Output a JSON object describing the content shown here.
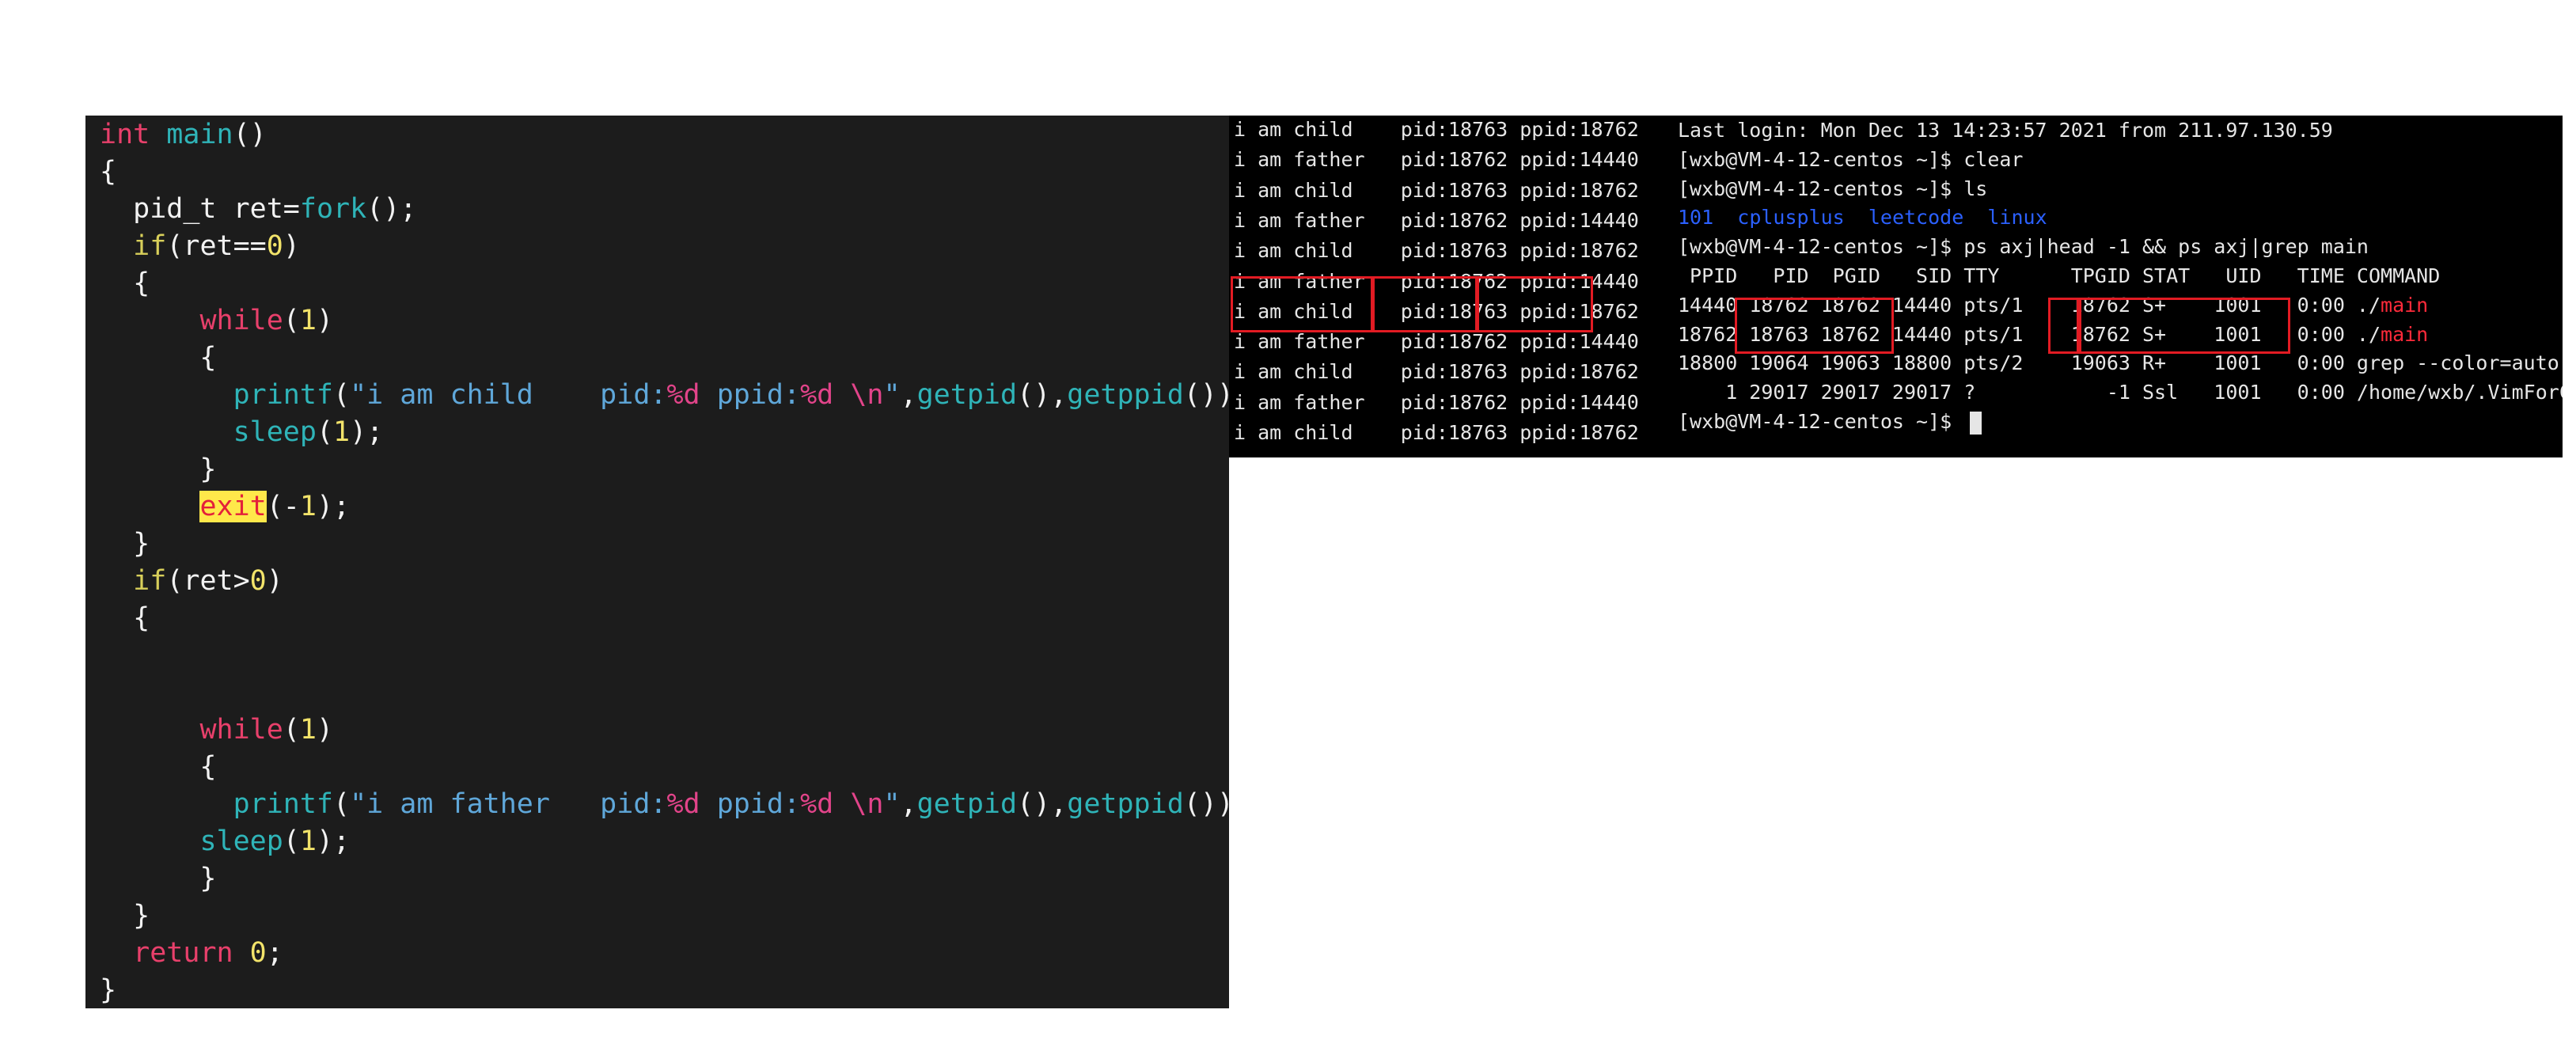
{
  "editor": {
    "lines": [
      [
        {
          "t": "int",
          "c": "kw"
        },
        {
          "t": " ",
          "c": "pl"
        },
        {
          "t": "main",
          "c": "fn"
        },
        {
          "t": "()",
          "c": "pl"
        }
      ],
      [
        {
          "t": "{",
          "c": "pl"
        }
      ],
      [
        {
          "t": "  pid_t ret=",
          "c": "pl"
        },
        {
          "t": "fork",
          "c": "fn"
        },
        {
          "t": "();",
          "c": "pl"
        }
      ],
      [
        {
          "t": "  ",
          "c": "pl"
        },
        {
          "t": "if",
          "c": "ctl"
        },
        {
          "t": "(ret==",
          "c": "pl"
        },
        {
          "t": "0",
          "c": "num"
        },
        {
          "t": ")",
          "c": "pl"
        }
      ],
      [
        {
          "t": "  {",
          "c": "pl"
        }
      ],
      [
        {
          "t": "      ",
          "c": "pl"
        },
        {
          "t": "while",
          "c": "kw"
        },
        {
          "t": "(",
          "c": "pl"
        },
        {
          "t": "1",
          "c": "num"
        },
        {
          "t": ")",
          "c": "pl"
        }
      ],
      [
        {
          "t": "      {",
          "c": "pl"
        }
      ],
      [
        {
          "t": "        ",
          "c": "pl"
        },
        {
          "t": "printf",
          "c": "fn"
        },
        {
          "t": "(",
          "c": "pl"
        },
        {
          "t": "\"i am child    pid:",
          "c": "str"
        },
        {
          "t": "%d",
          "c": "fmt"
        },
        {
          "t": " ppid:",
          "c": "str"
        },
        {
          "t": "%d",
          "c": "fmt"
        },
        {
          "t": " ",
          "c": "str"
        },
        {
          "t": "\\n",
          "c": "fmt"
        },
        {
          "t": "\"",
          "c": "str"
        },
        {
          "t": ",",
          "c": "pl"
        },
        {
          "t": "getpid",
          "c": "fn"
        },
        {
          "t": "(),",
          "c": "pl"
        },
        {
          "t": "getppid",
          "c": "fn"
        },
        {
          "t": "());",
          "c": "pl"
        }
      ],
      [
        {
          "t": "        ",
          "c": "pl"
        },
        {
          "t": "sleep",
          "c": "fn"
        },
        {
          "t": "(",
          "c": "pl"
        },
        {
          "t": "1",
          "c": "num"
        },
        {
          "t": ");",
          "c": "pl"
        }
      ],
      [
        {
          "t": "      }",
          "c": "pl"
        }
      ],
      [
        {
          "t": "      ",
          "c": "pl"
        },
        {
          "t": "exit",
          "c": "hl"
        },
        {
          "t": "(-",
          "c": "pl"
        },
        {
          "t": "1",
          "c": "num"
        },
        {
          "t": ");",
          "c": "pl"
        }
      ],
      [
        {
          "t": "  }",
          "c": "pl"
        }
      ],
      [
        {
          "t": "  ",
          "c": "pl"
        },
        {
          "t": "if",
          "c": "ctl"
        },
        {
          "t": "(ret>",
          "c": "pl"
        },
        {
          "t": "0",
          "c": "num"
        },
        {
          "t": ")",
          "c": "pl"
        }
      ],
      [
        {
          "t": "  {",
          "c": "pl"
        }
      ],
      [
        {
          "t": "",
          "c": "pl"
        }
      ],
      [
        {
          "t": "",
          "c": "pl"
        }
      ],
      [
        {
          "t": "      ",
          "c": "pl"
        },
        {
          "t": "while",
          "c": "kw"
        },
        {
          "t": "(",
          "c": "pl"
        },
        {
          "t": "1",
          "c": "num"
        },
        {
          "t": ")",
          "c": "pl"
        }
      ],
      [
        {
          "t": "      {",
          "c": "pl"
        }
      ],
      [
        {
          "t": "        ",
          "c": "pl"
        },
        {
          "t": "printf",
          "c": "fn"
        },
        {
          "t": "(",
          "c": "pl"
        },
        {
          "t": "\"i am father   pid:",
          "c": "str"
        },
        {
          "t": "%d",
          "c": "fmt"
        },
        {
          "t": " ppid:",
          "c": "str"
        },
        {
          "t": "%d",
          "c": "fmt"
        },
        {
          "t": " ",
          "c": "str"
        },
        {
          "t": "\\n",
          "c": "fmt"
        },
        {
          "t": "\"",
          "c": "str"
        },
        {
          "t": ",",
          "c": "pl"
        },
        {
          "t": "getpid",
          "c": "fn"
        },
        {
          "t": "(),",
          "c": "pl"
        },
        {
          "t": "getppid",
          "c": "fn"
        },
        {
          "t": "());",
          "c": "pl"
        }
      ],
      [
        {
          "t": "      ",
          "c": "pl"
        },
        {
          "t": "sleep",
          "c": "fn"
        },
        {
          "t": "(",
          "c": "pl"
        },
        {
          "t": "1",
          "c": "num"
        },
        {
          "t": ");",
          "c": "pl"
        }
      ],
      [
        {
          "t": "      }",
          "c": "pl"
        }
      ],
      [
        {
          "t": "  }",
          "c": "pl"
        }
      ],
      [
        {
          "t": "  ",
          "c": "pl"
        },
        {
          "t": "return",
          "c": "kw"
        },
        {
          "t": " ",
          "c": "pl"
        },
        {
          "t": "0",
          "c": "num"
        },
        {
          "t": ";",
          "c": "pl"
        }
      ],
      [
        {
          "t": "}",
          "c": "pl"
        }
      ]
    ]
  },
  "output": {
    "lines": [
      "i am child    pid:18763 ppid:18762",
      "i am father   pid:18762 ppid:14440",
      "i am child    pid:18763 ppid:18762",
      "i am father   pid:18762 ppid:14440",
      "i am child    pid:18763 ppid:18762",
      "i am father   pid:18762 ppid:14440",
      "i am child    pid:18763 ppid:18762",
      "i am father   pid:18762 ppid:14440",
      "i am child    pid:18763 ppid:18762",
      "i am father   pid:18762 ppid:14440",
      "i am child    pid:18763 ppid:18762"
    ]
  },
  "terminal": {
    "lines": [
      [
        {
          "t": "Last login: Mon Dec 13 14:23:57 2021 from 211.97.130.59"
        }
      ],
      [
        {
          "t": "[wxb@VM-4-12-centos ~]$ clear"
        }
      ],
      [
        {
          "t": "[wxb@VM-4-12-centos ~]$ ls"
        }
      ],
      [
        {
          "t": "101",
          "c": "ls"
        },
        {
          "t": "  "
        },
        {
          "t": "cplusplus",
          "c": "ls"
        },
        {
          "t": "  "
        },
        {
          "t": "leetcode",
          "c": "ls"
        },
        {
          "t": "  "
        },
        {
          "t": "linux",
          "c": "ls"
        }
      ],
      [
        {
          "t": "[wxb@VM-4-12-centos ~]$ ps axj|head -1 && ps axj|grep main"
        }
      ],
      [
        {
          "t": " PPID   PID  PGID   SID TTY      TPGID STAT   UID   TIME COMMAND"
        }
      ],
      [
        {
          "t": "14440 18762 18762 14440 pts/1    18762 S+    1001   0:00 ./"
        },
        {
          "t": "main",
          "c": "match"
        }
      ],
      [
        {
          "t": "18762 18763 18762 14440 pts/1    18762 S+    1001   0:00 ./"
        },
        {
          "t": "main",
          "c": "match"
        }
      ],
      [
        {
          "t": "18800 19064 19063 18800 pts/2    19063 R+    1001   0:00 grep --color=auto "
        },
        {
          "t": "main",
          "c": "match"
        }
      ],
      [
        {
          "t": "    1 29017 29017 29017 ?           -1 Ssl   1001   0:00 /home/wxb/.VimForCpp/nvim "
        },
        {
          "t": "main",
          "c": "match"
        },
        {
          "t": ".cpp"
        }
      ],
      [
        {
          "t": "[wxb@VM-4-12-centos ~]$ "
        },
        {
          "cursor": true
        }
      ]
    ]
  }
}
